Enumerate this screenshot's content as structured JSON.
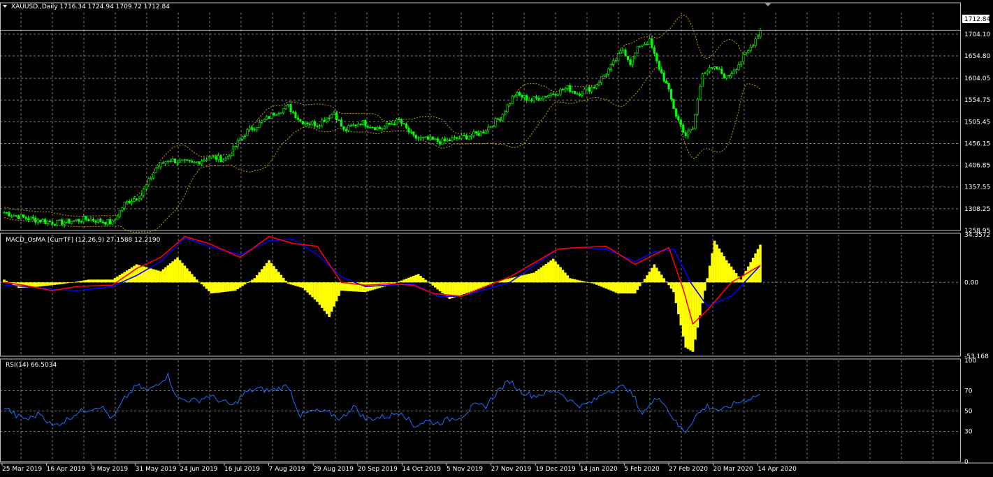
{
  "colors": {
    "background": "#000000",
    "grid": "#7a7a7a",
    "panel_border": "#c0c0c0",
    "text": "#ffffff",
    "candle": "#00ff00",
    "bands": "#c8a000",
    "macd_hist": "#ffff00",
    "macd_line": "#ff0000",
    "signal_line": "#0000ff",
    "rsi_line": "#1e6fff",
    "price_tag_bg": "#ffffff",
    "price_tag_text": "#000000"
  },
  "header": {
    "symbol_label": "XAUUSD.,Daily  1716.34 1724.94 1709.72 1712.84",
    "macd_label": "MACD_OsMA [CurrTF] (12,26,9) 27.1588 12.2190",
    "rsi_label": "RSI(14) 66.5034"
  },
  "current_price": "1712.84",
  "x_axis": {
    "ticks": [
      "25 Mar 2019",
      "16 Apr 2019",
      "9 May 2019",
      "31 May 2019",
      "24 Jun 2019",
      "16 Jul 2019",
      "7 Aug 2019",
      "29 Aug 2019",
      "20 Sep 2019",
      "14 Oct 2019",
      "5 Nov 2019",
      "27 Nov 2019",
      "19 Dec 2019",
      "14 Jan 2020",
      "5 Feb 2020",
      "27 Feb 2020",
      "20 Mar 2020",
      "14 Apr 2020"
    ]
  },
  "chart_data": [
    {
      "type": "line",
      "panel": "price",
      "y_ticks": [
        "1704.10",
        "1654.80",
        "1604.05",
        "1554.75",
        "1505.45",
        "1456.15",
        "1406.85",
        "1357.55",
        "1308.25",
        "1258.95"
      ],
      "ylim": [
        1258.95,
        1753
      ],
      "anchors": [
        {
          "d": 0,
          "v": 1300
        },
        {
          "d": 8,
          "v": 1288
        },
        {
          "d": 22,
          "v": 1276
        },
        {
          "d": 35,
          "v": 1285
        },
        {
          "d": 45,
          "v": 1276
        },
        {
          "d": 50,
          "v": 1320
        },
        {
          "d": 57,
          "v": 1340
        },
        {
          "d": 63,
          "v": 1400
        },
        {
          "d": 68,
          "v": 1420
        },
        {
          "d": 78,
          "v": 1410
        },
        {
          "d": 85,
          "v": 1425
        },
        {
          "d": 92,
          "v": 1420
        },
        {
          "d": 100,
          "v": 1480
        },
        {
          "d": 108,
          "v": 1508
        },
        {
          "d": 112,
          "v": 1525
        },
        {
          "d": 118,
          "v": 1540
        },
        {
          "d": 123,
          "v": 1507
        },
        {
          "d": 130,
          "v": 1500
        },
        {
          "d": 137,
          "v": 1527
        },
        {
          "d": 141,
          "v": 1485
        },
        {
          "d": 148,
          "v": 1505
        },
        {
          "d": 156,
          "v": 1490
        },
        {
          "d": 164,
          "v": 1508
        },
        {
          "d": 170,
          "v": 1470
        },
        {
          "d": 182,
          "v": 1460
        },
        {
          "d": 190,
          "v": 1470
        },
        {
          "d": 198,
          "v": 1480
        },
        {
          "d": 206,
          "v": 1515
        },
        {
          "d": 212,
          "v": 1568
        },
        {
          "d": 219,
          "v": 1555
        },
        {
          "d": 228,
          "v": 1570
        },
        {
          "d": 234,
          "v": 1582
        },
        {
          "d": 238,
          "v": 1570
        },
        {
          "d": 245,
          "v": 1585
        },
        {
          "d": 252,
          "v": 1630
        },
        {
          "d": 257,
          "v": 1670
        },
        {
          "d": 260,
          "v": 1640
        },
        {
          "d": 264,
          "v": 1680
        },
        {
          "d": 268,
          "v": 1688
        },
        {
          "d": 271,
          "v": 1640
        },
        {
          "d": 275,
          "v": 1590
        },
        {
          "d": 279,
          "v": 1520
        },
        {
          "d": 283,
          "v": 1475
        },
        {
          "d": 286,
          "v": 1490
        },
        {
          "d": 290,
          "v": 1620
        },
        {
          "d": 296,
          "v": 1625
        },
        {
          "d": 300,
          "v": 1605
        },
        {
          "d": 304,
          "v": 1630
        },
        {
          "d": 309,
          "v": 1665
        },
        {
          "d": 314,
          "v": 1712.84
        }
      ],
      "bands_width": 40
    },
    {
      "type": "bar",
      "panel": "macd",
      "y_ticks": [
        "34.3572",
        "0.00",
        "-53.168"
      ],
      "ylim": [
        -53.168,
        34.3572
      ],
      "series": [
        {
          "name": "OsMA",
          "kind": "histogram",
          "points": [
            [
              0,
              2
            ],
            [
              6,
              -4
            ],
            [
              15,
              -3
            ],
            [
              25,
              -1
            ],
            [
              35,
              2
            ],
            [
              45,
              2
            ],
            [
              55,
              13
            ],
            [
              65,
              8
            ],
            [
              72,
              18
            ],
            [
              80,
              2
            ],
            [
              86,
              -8
            ],
            [
              96,
              -6
            ],
            [
              104,
              3
            ],
            [
              110,
              16
            ],
            [
              118,
              -1
            ],
            [
              124,
              -4
            ],
            [
              130,
              -14
            ],
            [
              135,
              -25
            ],
            [
              140,
              -6
            ],
            [
              150,
              -7
            ],
            [
              160,
              -2
            ],
            [
              172,
              6
            ],
            [
              185,
              -12
            ],
            [
              195,
              -6
            ],
            [
              205,
              1
            ],
            [
              220,
              7
            ],
            [
              228,
              17
            ],
            [
              235,
              3
            ],
            [
              245,
              -1
            ],
            [
              255,
              -8
            ],
            [
              262,
              -8
            ],
            [
              270,
              13
            ],
            [
              278,
              -7
            ],
            [
              283,
              -47
            ],
            [
              286,
              -50
            ],
            [
              290,
              -15
            ],
            [
              295,
              30
            ],
            [
              300,
              16
            ],
            [
              306,
              2
            ],
            [
              314,
              27.16
            ]
          ]
        },
        {
          "name": "MACD",
          "kind": "line",
          "points": [
            [
              0,
              0
            ],
            [
              8,
              -2
            ],
            [
              20,
              -6
            ],
            [
              30,
              -3
            ],
            [
              45,
              -2
            ],
            [
              55,
              10
            ],
            [
              65,
              18
            ],
            [
              75,
              33
            ],
            [
              85,
              28
            ],
            [
              98,
              18
            ],
            [
              110,
              33
            ],
            [
              120,
              28
            ],
            [
              130,
              26
            ],
            [
              140,
              0
            ],
            [
              150,
              -2
            ],
            [
              160,
              -1
            ],
            [
              170,
              -2
            ],
            [
              178,
              -8
            ],
            [
              190,
              -10
            ],
            [
              210,
              4
            ],
            [
              230,
              24
            ],
            [
              238,
              25
            ],
            [
              250,
              26
            ],
            [
              262,
              13
            ],
            [
              270,
              20
            ],
            [
              276,
              25
            ],
            [
              282,
              -5
            ],
            [
              286,
              -30
            ],
            [
              292,
              -20
            ],
            [
              302,
              0
            ],
            [
              314,
              12.22
            ]
          ]
        },
        {
          "name": "Signal",
          "kind": "line",
          "points": [
            [
              0,
              -2
            ],
            [
              10,
              -3
            ],
            [
              20,
              -5
            ],
            [
              30,
              -6
            ],
            [
              45,
              -3
            ],
            [
              55,
              5
            ],
            [
              65,
              15
            ],
            [
              75,
              32
            ],
            [
              85,
              26
            ],
            [
              98,
              20
            ],
            [
              110,
              30
            ],
            [
              120,
              31
            ],
            [
              130,
              20
            ],
            [
              140,
              4
            ],
            [
              150,
              -3
            ],
            [
              160,
              -2
            ],
            [
              170,
              -1
            ],
            [
              180,
              -10
            ],
            [
              190,
              -10
            ],
            [
              210,
              0
            ],
            [
              230,
              24
            ],
            [
              238,
              25
            ],
            [
              250,
              24
            ],
            [
              262,
              15
            ],
            [
              270,
              22
            ],
            [
              278,
              24
            ],
            [
              285,
              0
            ],
            [
              292,
              -17
            ],
            [
              302,
              -10
            ],
            [
              314,
              12.22
            ]
          ]
        }
      ]
    },
    {
      "type": "line",
      "panel": "rsi",
      "y_ticks": [
        "100",
        "70",
        "50",
        "30",
        "0"
      ],
      "ylim": [
        0,
        100
      ],
      "levels": [
        70,
        50,
        30
      ],
      "series": [
        {
          "name": "RSI(14)",
          "points": [
            [
              0,
              55
            ],
            [
              5,
              45
            ],
            [
              10,
              42
            ],
            [
              15,
              48
            ],
            [
              20,
              35
            ],
            [
              25,
              40
            ],
            [
              30,
              48
            ],
            [
              35,
              52
            ],
            [
              40,
              55
            ],
            [
              45,
              42
            ],
            [
              50,
              62
            ],
            [
              55,
              75
            ],
            [
              60,
              70
            ],
            [
              65,
              80
            ],
            [
              68,
              85
            ],
            [
              72,
              62
            ],
            [
              80,
              60
            ],
            [
              85,
              65
            ],
            [
              95,
              55
            ],
            [
              100,
              68
            ],
            [
              105,
              72
            ],
            [
              110,
              70
            ],
            [
              118,
              75
            ],
            [
              123,
              45
            ],
            [
              128,
              50
            ],
            [
              135,
              48
            ],
            [
              140,
              42
            ],
            [
              145,
              55
            ],
            [
              150,
              42
            ],
            [
              160,
              45
            ],
            [
              165,
              50
            ],
            [
              170,
              35
            ],
            [
              175,
              40
            ],
            [
              180,
              38
            ],
            [
              185,
              42
            ],
            [
              190,
              45
            ],
            [
              195,
              55
            ],
            [
              200,
              55
            ],
            [
              205,
              70
            ],
            [
              210,
              80
            ],
            [
              214,
              70
            ],
            [
              220,
              65
            ],
            [
              225,
              68
            ],
            [
              230,
              70
            ],
            [
              235,
              60
            ],
            [
              240,
              55
            ],
            [
              245,
              60
            ],
            [
              250,
              70
            ],
            [
              255,
              72
            ],
            [
              258,
              75
            ],
            [
              262,
              62
            ],
            [
              264,
              48
            ],
            [
              268,
              55
            ],
            [
              272,
              65
            ],
            [
              276,
              50
            ],
            [
              280,
              35
            ],
            [
              283,
              30
            ],
            [
              287,
              45
            ],
            [
              292,
              55
            ],
            [
              298,
              50
            ],
            [
              304,
              58
            ],
            [
              309,
              62
            ],
            [
              314,
              66.5
            ]
          ]
        }
      ]
    }
  ]
}
